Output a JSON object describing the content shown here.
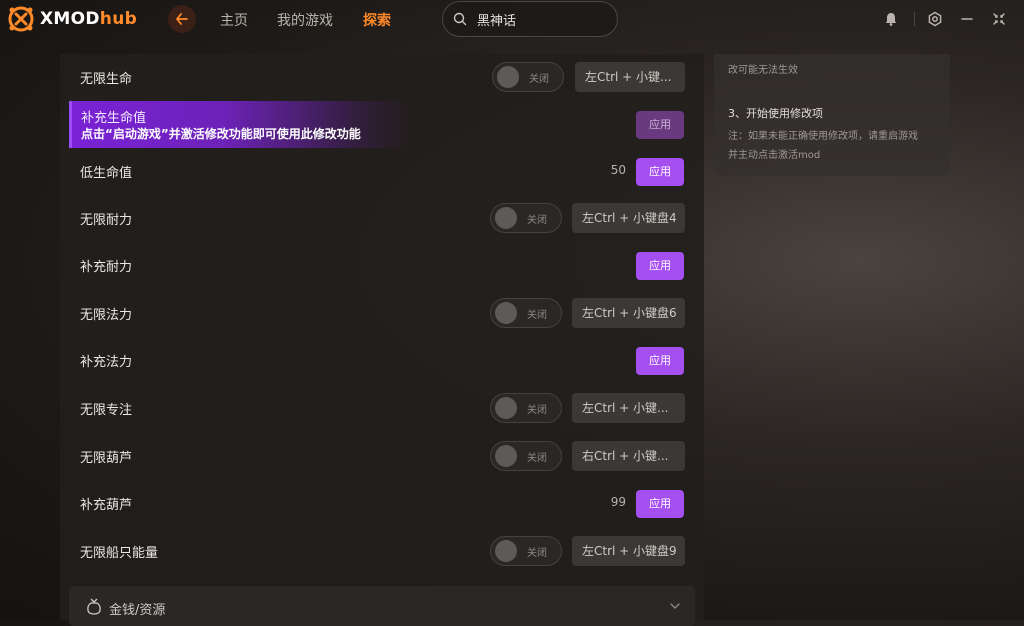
{
  "app": {
    "brand_main": "XMOD",
    "brand_accent": "hub",
    "accent_color": "#ff8a2a",
    "purple_color": "#a64ff0"
  },
  "nav": {
    "home": "主页",
    "my_games": "我的游戏",
    "explore": "探索"
  },
  "search": {
    "value": "黑神话"
  },
  "rows": [
    {
      "label": "无限生命",
      "toggle": "关闭",
      "hotkey": "左Ctrl + 小键..."
    },
    {
      "label": "补充生命值",
      "apply": "应用"
    },
    {
      "label": "低生命值",
      "value": "50",
      "apply": "应用"
    },
    {
      "label": "无限耐力",
      "toggle": "关闭",
      "hotkey": "左Ctrl + 小键盘4"
    },
    {
      "label": "补充耐力",
      "apply": "应用"
    },
    {
      "label": "无限法力",
      "toggle": "关闭",
      "hotkey": "左Ctrl + 小键盘6"
    },
    {
      "label": "补充法力",
      "apply": "应用"
    },
    {
      "label": "无限专注",
      "toggle": "关闭",
      "hotkey": "左Ctrl + 小键..."
    },
    {
      "label": "无限葫芦",
      "toggle": "关闭",
      "hotkey": "右Ctrl + 小键..."
    },
    {
      "label": "补充葫芦",
      "value": "99",
      "apply": "应用"
    },
    {
      "label": "无限船只能量",
      "toggle": "关闭",
      "hotkey": "左Ctrl + 小键盘9"
    }
  ],
  "tip": {
    "text": "点击“启动游戏”并激活修改功能即可使用此修改功能"
  },
  "category": {
    "label": "金钱/资源",
    "icon": "money-bag-icon"
  },
  "info": {
    "line_top": "改可能无法生效",
    "step3": "3、开始使用修改项",
    "note1": "注：如果未能正确使用修改项，请重启游戏",
    "note2": "并主动点击激活mod"
  }
}
